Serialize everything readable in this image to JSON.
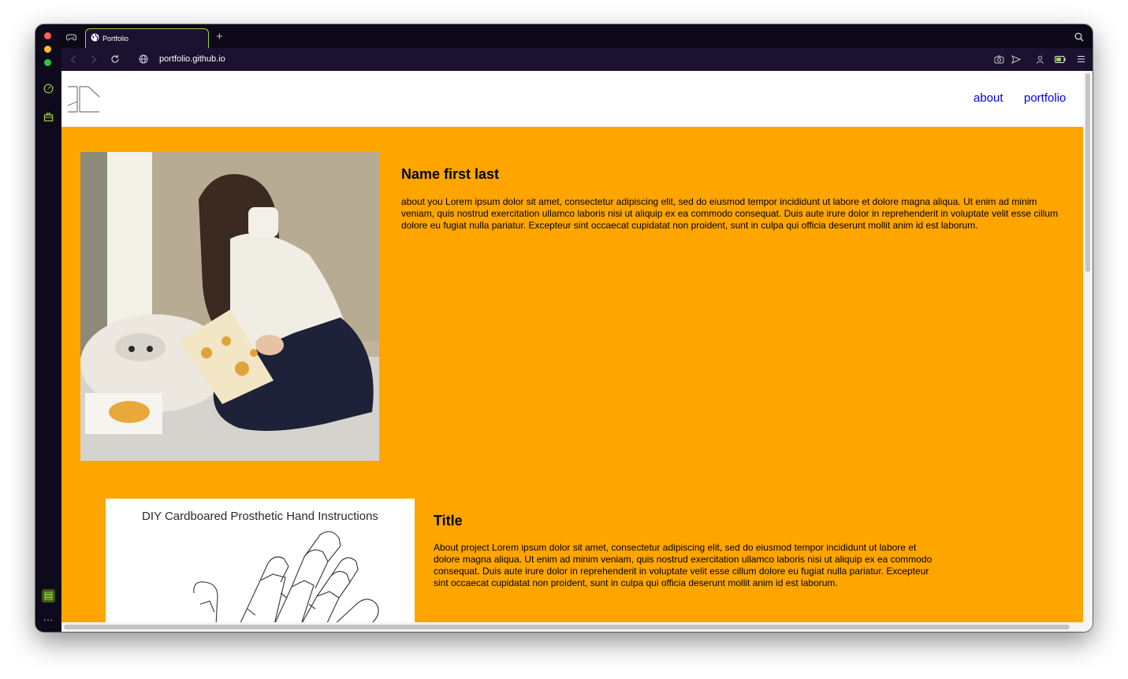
{
  "browser": {
    "tab_title": "Portfolio",
    "new_tab_label": "+",
    "url": "portfolio.github.io",
    "more_label": "..."
  },
  "site": {
    "nav": [
      {
        "label": "about"
      },
      {
        "label": "portfolio"
      }
    ],
    "profile": {
      "name": "Name first last",
      "about": "about you Lorem ipsum dolor sit amet, consectetur adipiscing elit, sed do eiusmod tempor incididunt ut labore et dolore magna aliqua. Ut enim ad minim veniam, quis nostrud exercitation ullamco laboris nisi ut aliquip ex ea commodo consequat. Duis aute irure dolor in reprehenderit in voluptate velit esse cillum dolore eu fugiat nulla pariatur. Excepteur sint occaecat cupidatat non proident, sunt in culpa qui officia deserunt mollit anim id est laborum."
    },
    "project": {
      "image_caption": "DIY Cardboared Prosthetic Hand Instructions",
      "title": "Title",
      "about": "About project Lorem ipsum dolor sit amet, consectetur adipiscing elit, sed do eiusmod tempor incididunt ut labore et dolore magna aliqua. Ut enim ad minim veniam, quis nostrud exercitation ullamco laboris nisi ut aliquip ex ea commodo consequat. Duis aute irure dolor in reprehenderit in voluptate velit esse cillum dolore eu fugiat nulla pariatur. Excepteur sint occaecat cupidatat non proident, sunt in culpa qui officia deserunt mollit anim id est laborum."
    }
  },
  "colors": {
    "accent": "#ffa500",
    "link": "#0000ee",
    "browser_bg": "#0e0a1c",
    "tab_outline": "#9ad33f"
  },
  "icons": [
    "gamepad-icon",
    "globe-icon",
    "back-icon",
    "forward-icon",
    "reload-icon",
    "site-info-icon",
    "camera-icon",
    "send-icon",
    "profile-icon",
    "battery-icon",
    "menu-icon",
    "search-icon",
    "speed-dial-icon",
    "briefcase-icon",
    "workspaces-icon"
  ]
}
